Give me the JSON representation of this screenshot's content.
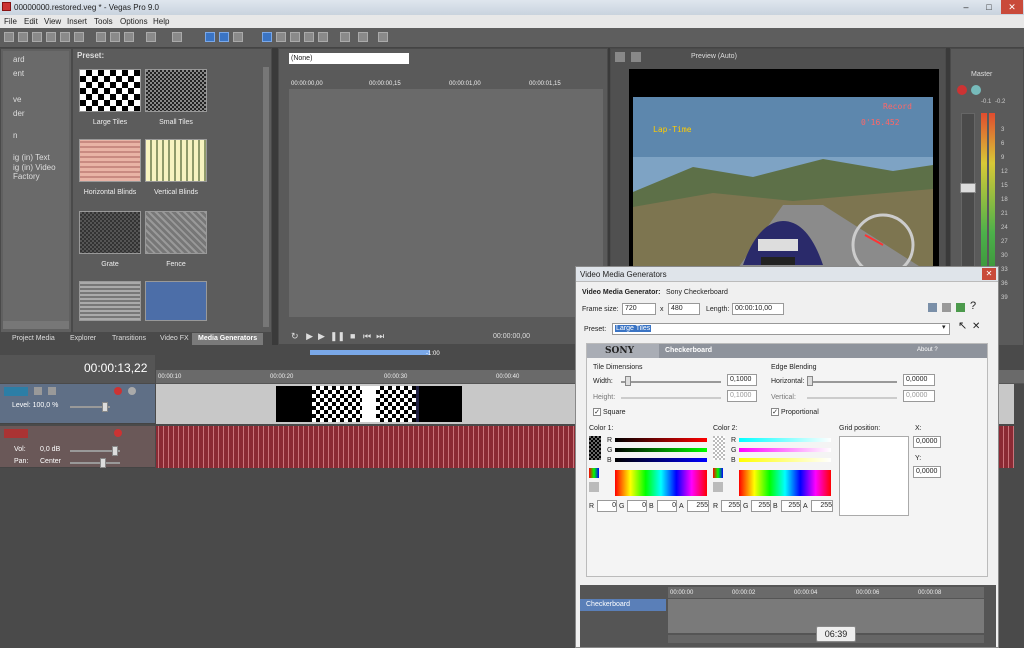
{
  "window": {
    "title": "00000000.restored.veg * - Vegas Pro 9.0",
    "minimize": "–",
    "maximize": "□",
    "close": "✕"
  },
  "menu": [
    "File",
    "Edit",
    "View",
    "Insert",
    "Tools",
    "Options",
    "Help"
  ],
  "explorer": {
    "items": [
      "ard",
      "ent",
      "",
      "ve",
      "der",
      "",
      "n",
      "",
      "ig (in) Text",
      "ig (in) Video Factory"
    ],
    "tabs": [
      "Project Media",
      "Explorer",
      "Transitions",
      "Video FX",
      "Media Generators"
    ]
  },
  "presets": {
    "header": "Preset:",
    "tiles": [
      "Large Tiles",
      "Small Tiles",
      "Horizontal Blinds",
      "Vertical Blinds",
      "Grate",
      "Fence",
      "",
      ""
    ]
  },
  "trimmer": {
    "select_value": "(None)",
    "ticks": [
      "00:00:00,00",
      "00:00:00,15",
      "00:00:01,00",
      "00:00:01,15"
    ],
    "time": "00:00:00,00"
  },
  "preview": {
    "mode": "Preview (Auto)"
  },
  "mixer": {
    "label": "Master",
    "levels": [
      "-0.1",
      "-0.2",
      "3",
      "6",
      "9",
      "12",
      "15",
      "18",
      "21",
      "24",
      "27",
      "30",
      "33",
      "36",
      "39"
    ]
  },
  "timeline": {
    "cursor_time": "00:00:13,22",
    "ticks": [
      "00:00:10",
      "00:00:20",
      "00:00:30",
      "00:00:40"
    ],
    "marker": "-1:00",
    "video_track": {
      "level": "Level: 100,0 %"
    },
    "audio_track": {
      "vol": "Vol:",
      "vol_value": "0,0 dB",
      "pan": "Pan:",
      "pan_value": "Center"
    }
  },
  "dialog": {
    "title": "Video Media Generators",
    "generator": "Video Media Generator:",
    "generator_value": "Sony Checkerboard",
    "frame_size_label": "Frame size:",
    "frame_w": "720",
    "x": "x",
    "frame_h": "480",
    "length_label": "Length:",
    "length": "00:00:10,00",
    "preset_label": "Preset:",
    "preset_value": "Large Tiles",
    "plugin_brand": "SONY",
    "plugin_name": "Checkerboard",
    "about": "About  ?",
    "tile_dim": "Tile Dimensions",
    "width_label": "Width:",
    "width_value": "0,1000",
    "height_label": "Height:",
    "height_value": "0,1000",
    "square": "Square",
    "edge_blend": "Edge Blending",
    "horizontal_label": "Horizontal:",
    "horizontal_value": "0,0000",
    "vertical_label": "Vertical:",
    "vertical_value": "0,0000",
    "proportional": "Proportional",
    "color1": "Color 1:",
    "color2": "Color 2:",
    "grid_pos": "Grid position:",
    "gx_label": "X:",
    "gx_value": "0,0000",
    "gy_label": "Y:",
    "gy_value": "0,0000",
    "rgba_labels": [
      "R",
      "G",
      "B",
      "A"
    ],
    "color1_values": [
      "0",
      "0",
      "0",
      "255"
    ],
    "color2_values": [
      "255",
      "255",
      "255",
      "255"
    ],
    "channel_letters": [
      "R",
      "G",
      "B"
    ],
    "track_name": "Checkerboard",
    "mini_ticks": [
      "00:00:00",
      "00:00:02",
      "00:00:04",
      "00:00:06",
      "00:00:08"
    ]
  },
  "overlay_time": "06:39"
}
